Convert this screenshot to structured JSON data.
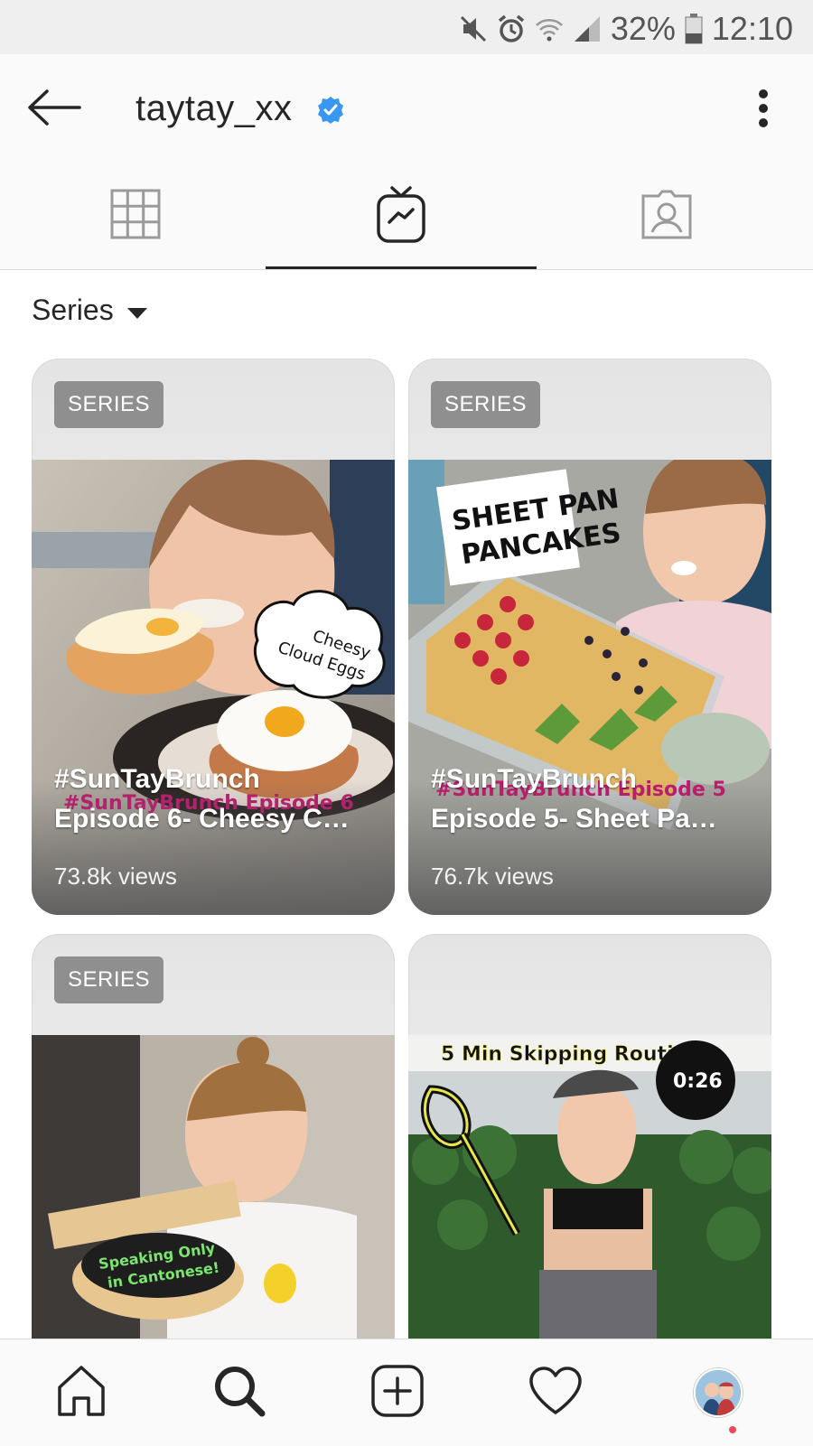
{
  "status_bar": {
    "battery": "32%",
    "time": "12:10"
  },
  "header": {
    "username": "taytay_xx",
    "verified": true
  },
  "tabs": [
    {
      "name": "grid",
      "icon": "grid-icon",
      "active": false
    },
    {
      "name": "igtv",
      "icon": "igtv-icon",
      "active": true
    },
    {
      "name": "tagged",
      "icon": "tagged-user-icon",
      "active": false
    }
  ],
  "filter": {
    "label": "Series"
  },
  "videos": [
    {
      "badge": "SERIES",
      "series_tag": "#SunTayBrunch",
      "title": "Episode 6- Cheesy C…",
      "views": "73.8k views",
      "thumb_text": "Cheesy Cloud Eggs",
      "thumb_subtext": "#SunTayBrunch Episode 6"
    },
    {
      "badge": "SERIES",
      "series_tag": "#SunTayBrunch",
      "title": "Episode 5- Sheet Pa…",
      "views": "76.7k views",
      "thumb_text": "SHEET PAN PANCAKES",
      "thumb_subtext": "#SunTayBrunch Episode 5"
    },
    {
      "badge": "SERIES",
      "thumb_text": "Speaking Only in Cantonese!"
    },
    {
      "thumb_text": "5 Min Skipping Routine",
      "duration": "0:26"
    }
  ],
  "bottom_nav": [
    {
      "name": "home",
      "icon": "home-icon"
    },
    {
      "name": "search",
      "icon": "search-icon"
    },
    {
      "name": "new-post",
      "icon": "add-post-icon"
    },
    {
      "name": "activity",
      "icon": "heart-icon"
    },
    {
      "name": "profile",
      "icon": "profile-avatar"
    }
  ],
  "colors": {
    "verified_blue": "#3897f0",
    "notification_red": "#ed4956",
    "active_tab": "#262626"
  }
}
